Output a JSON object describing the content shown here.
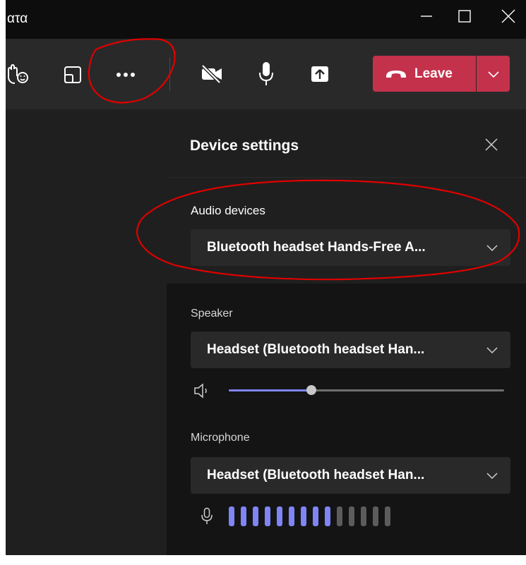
{
  "window": {
    "title": "ατα"
  },
  "toolbar": {
    "icons": [
      "react-icon",
      "share-tray-icon",
      "more-options-icon",
      "camera-off-icon",
      "microphone-icon",
      "share-screen-icon"
    ],
    "leave_label": "Leave",
    "leave_color": "#c4314b"
  },
  "panel": {
    "title": "Device settings",
    "audio_devices": {
      "label": "Audio devices",
      "value": "Bluetooth headset Hands-Free A..."
    },
    "speaker": {
      "label": "Speaker",
      "value": "Headset (Bluetooth headset Han...",
      "volume": 0.3
    },
    "microphone": {
      "label": "Microphone",
      "value": "Headset (Bluetooth headset Han...",
      "level_bars_active": 9,
      "level_bars_total": 14
    }
  },
  "annotations": {
    "color": "#e00000",
    "highlighted": [
      "more-options-button",
      "audio-devices-section"
    ]
  },
  "accent_color": "#7f85f5"
}
